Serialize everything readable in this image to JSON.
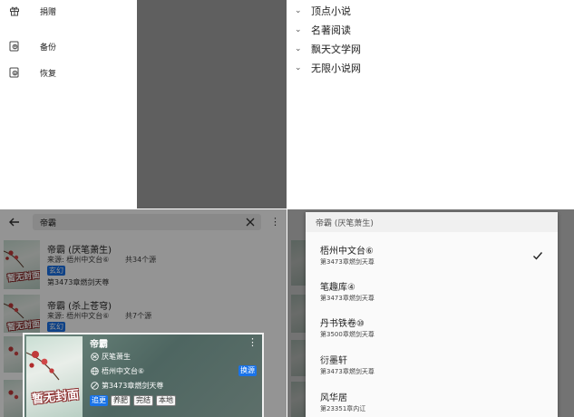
{
  "menu_panel": {
    "items": [
      {
        "label": "捐赠",
        "icon": "gift-icon"
      },
      {
        "label": "备份",
        "icon": "backup-icon"
      },
      {
        "label": "恢复",
        "icon": "restore-icon"
      }
    ]
  },
  "source_list": {
    "groups": [
      "顶点小说",
      "名著阅读",
      "飘天文学网",
      "无限小说网"
    ]
  },
  "search": {
    "query": "帝霸",
    "results": [
      {
        "title": "帝霸 (厌笔萧生)",
        "source": "来源: 梧州中文台⑥",
        "count": "共34个源",
        "tag": "玄幻",
        "latest": "第3473章燃剑天尊",
        "cover_text": "暂无封面"
      },
      {
        "title": "帝霸 (杀上苍穹)",
        "source": "来源: 梧州中文台⑥",
        "count": "共7个源",
        "tag": "玄幻",
        "latest": "",
        "cover_text": "暂无封面"
      }
    ]
  },
  "book_card": {
    "title": "帝霸",
    "author": "厌笔萧生",
    "source": "梧州中文台⑥",
    "latest": "第3473章燃剑天尊",
    "change_source": "换源",
    "tags": [
      "追更",
      "养肥",
      "完结",
      "本地"
    ],
    "cover_text": "暂无封面"
  },
  "source_picker": {
    "title": "帝霸 (厌笔萧生)",
    "items": [
      {
        "name": "梧州中文台⑥",
        "chapter": "第3473章燃剑天尊",
        "selected": true
      },
      {
        "name": "笔趣库④",
        "chapter": "第3473章燃剑天尊",
        "selected": false
      },
      {
        "name": "丹书铁卷⑩",
        "chapter": "第3500章燃剑天尊",
        "selected": false
      },
      {
        "name": "衍墨轩",
        "chapter": "第3473章燃剑天尊",
        "selected": false
      },
      {
        "name": "风华居",
        "chapter": "第23351章内讧",
        "selected": false
      }
    ]
  },
  "colors": {
    "accent": "#1a73e8",
    "dim": "#5f5f5f"
  }
}
